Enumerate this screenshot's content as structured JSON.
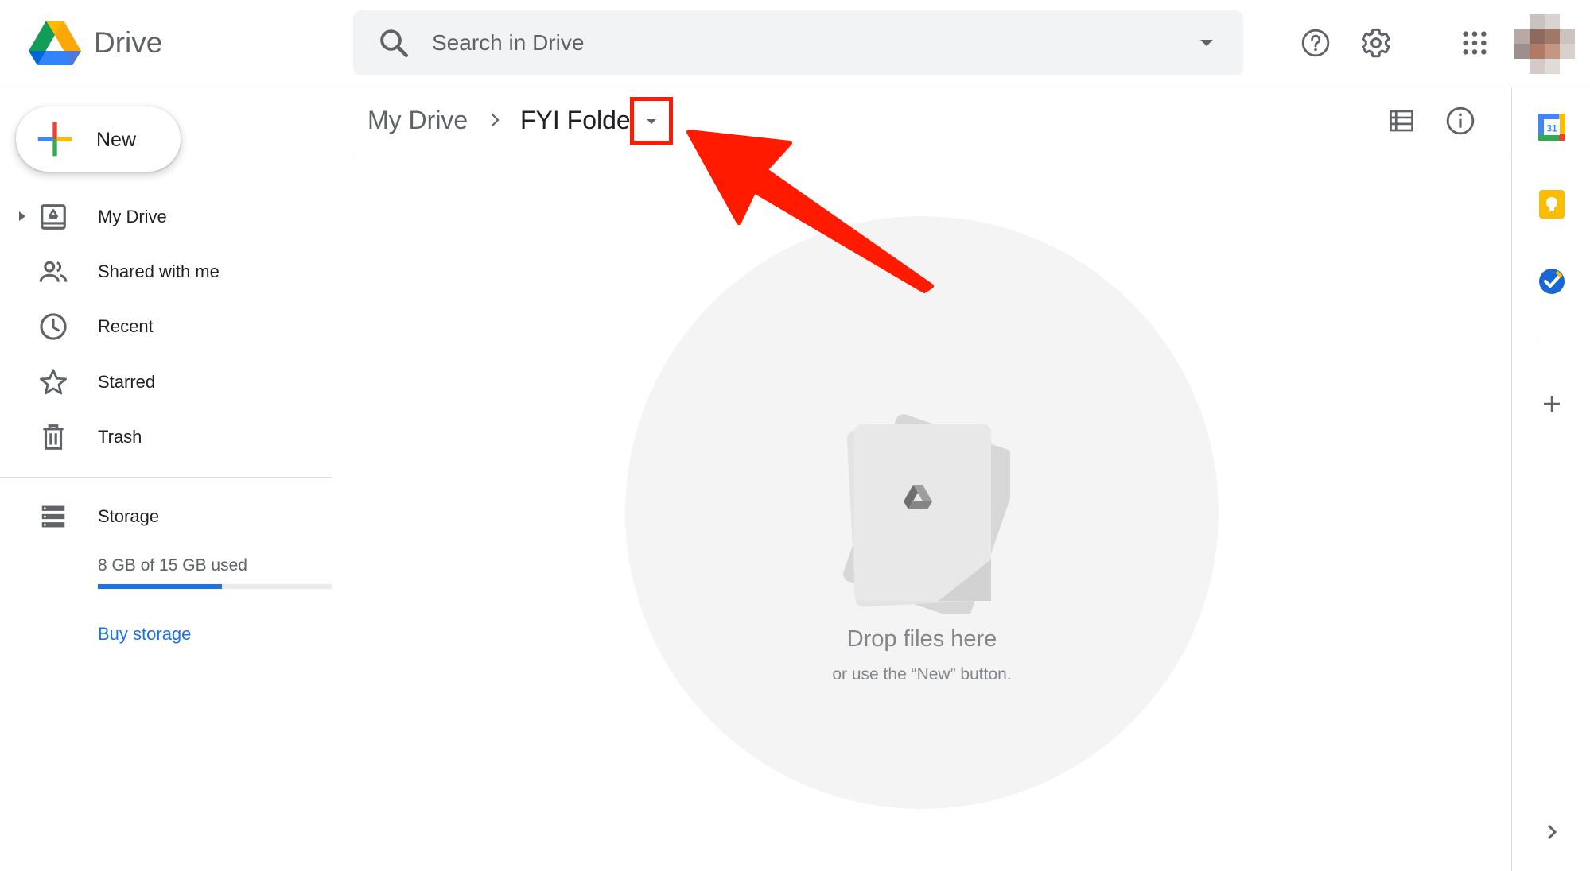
{
  "app": {
    "name": "Drive"
  },
  "header": {
    "search_placeholder": "Search in Drive",
    "icons": [
      "drive-logo-icon",
      "search-icon",
      "search-options-icon",
      "help-icon",
      "settings-icon",
      "apps-grid-icon",
      "account-avatar"
    ]
  },
  "sidebar": {
    "new_label": "New",
    "items": [
      {
        "label": "My Drive",
        "icon": "my-drive-icon",
        "expandable": true
      },
      {
        "label": "Shared with me",
        "icon": "shared-icon"
      },
      {
        "label": "Recent",
        "icon": "recent-icon"
      },
      {
        "label": "Starred",
        "icon": "star-icon"
      },
      {
        "label": "Trash",
        "icon": "trash-icon"
      }
    ],
    "storage": {
      "label": "Storage",
      "usage_text": "8 GB of 15 GB used",
      "used_fraction": 0.53,
      "buy_label": "Buy storage"
    }
  },
  "main": {
    "breadcrumb": {
      "root": "My Drive",
      "current": "FYI Folder"
    },
    "empty_state": {
      "title": "Drop files here",
      "subtitle": "or use the “New” button."
    }
  },
  "side_panel": {
    "calendar_day": "31",
    "icons": [
      "calendar-icon",
      "keep-icon",
      "tasks-icon",
      "add-addon-icon",
      "expand-panel-icon"
    ]
  },
  "colors": {
    "accent": "#1a73e8",
    "annotation": "#ff1a00",
    "text_primary": "#202124",
    "text_secondary": "#5f6368",
    "keep": "#fbbc04"
  }
}
